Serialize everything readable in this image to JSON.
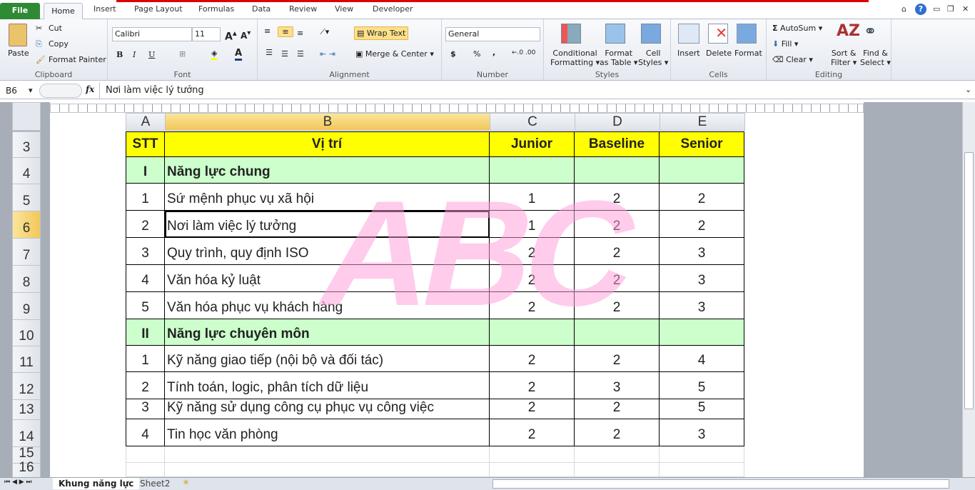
{
  "ribbon_tabs": [
    "File",
    "Home",
    "Insert",
    "Page Layout",
    "Formulas",
    "Data",
    "Review",
    "View",
    "Developer"
  ],
  "clipboard": {
    "paste": "Paste",
    "cut": "Cut",
    "copy": "Copy",
    "format_painter": "Format Painter",
    "label": "Clipboard"
  },
  "font": {
    "name": "Calibri",
    "size": "11",
    "label": "Font",
    "bold": "B",
    "italic": "I",
    "underline": "U"
  },
  "alignment": {
    "wrap_text": "Wrap Text",
    "merge_center": "Merge & Center",
    "label": "Alignment"
  },
  "number": {
    "format": "General",
    "currency": "$",
    "percent": "%",
    "comma": ",",
    "label": "Number"
  },
  "styles": {
    "conditional": "Conditional",
    "formatting": "Formatting",
    "format": "Format",
    "as_table": "as Table",
    "cell": "Cell",
    "cell_styles": "Styles",
    "label": "Styles"
  },
  "cells": {
    "insert": "Insert",
    "delete": "Delete",
    "format": "Format",
    "label": "Cells"
  },
  "editing": {
    "autosum": "AutoSum",
    "fill": "Fill",
    "clear": "Clear",
    "sort": "Sort &",
    "filter": "Filter",
    "find": "Find &",
    "select": "Select",
    "label": "Editing"
  },
  "formula_bar": {
    "name_box": "B6",
    "fx": "fx",
    "value": "Nơi làm việc lý tưởng"
  },
  "columns": [
    "A",
    "B",
    "C",
    "D",
    "E"
  ],
  "rows": [
    {
      "num": "3",
      "cells": [
        "STT",
        "Vị trí",
        "Junior",
        "Baseline",
        "Senior"
      ],
      "type": "header"
    },
    {
      "num": "4",
      "cells": [
        "I",
        "Năng lực chung",
        "",
        "",
        ""
      ],
      "type": "section"
    },
    {
      "num": "5",
      "cells": [
        "1",
        "Sứ mệnh phục vụ xã hội",
        "1",
        "2",
        "2"
      ]
    },
    {
      "num": "6",
      "cells": [
        "2",
        "Nơi làm việc lý tưởng",
        "1",
        "2",
        "2"
      ]
    },
    {
      "num": "7",
      "cells": [
        "3",
        "Quy trình, quy định ISO",
        "2",
        "2",
        "3"
      ]
    },
    {
      "num": "8",
      "cells": [
        "4",
        "Văn hóa kỷ luật",
        "2",
        "2",
        "3"
      ]
    },
    {
      "num": "9",
      "cells": [
        "5",
        "Văn hóa phục vụ khách hàng",
        "2",
        "2",
        "3"
      ]
    },
    {
      "num": "10",
      "cells": [
        "II",
        "Năng lực chuyên môn",
        "",
        "",
        ""
      ],
      "type": "section"
    },
    {
      "num": "11",
      "cells": [
        "1",
        "Kỹ năng giao tiếp (nội bộ và đối tác)",
        "2",
        "2",
        "4"
      ]
    },
    {
      "num": "12",
      "cells": [
        "2",
        "Tính toán, logic, phân tích dữ liệu",
        "2",
        "3",
        "5"
      ]
    },
    {
      "num": "13",
      "cells": [
        "3",
        "Kỹ năng sử dụng công cụ phục vụ công việc",
        "2",
        "2",
        "5"
      ]
    },
    {
      "num": "14",
      "cells": [
        "4",
        "Tin học văn phòng",
        "2",
        "2",
        "3"
      ]
    },
    {
      "num": "15",
      "cells": [
        "",
        "",
        "",
        "",
        ""
      ],
      "type": "empty"
    },
    {
      "num": "16",
      "cells": [
        "",
        "",
        "",
        "",
        ""
      ],
      "type": "empty"
    }
  ],
  "watermark": "ABC",
  "sheet_tabs": [
    "Khung năng lực",
    "Sheet2"
  ],
  "colors": {
    "header_fill": "#ffff00",
    "section_fill": "#ccffcc",
    "file_tab": "#2f8a34",
    "watermark": "#ff9ad8"
  }
}
